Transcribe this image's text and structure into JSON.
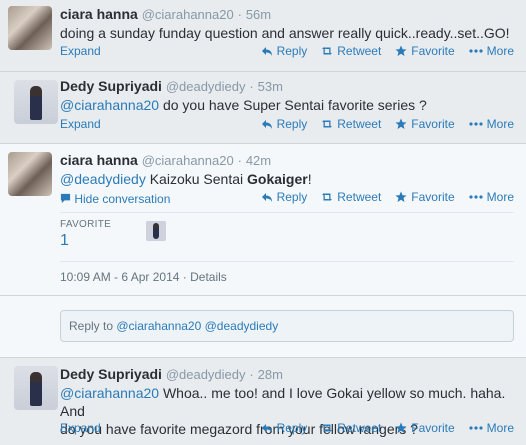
{
  "actions": {
    "reply": "Reply",
    "retweet": "Retweet",
    "favorite": "Favorite",
    "more": "More"
  },
  "tweets": [
    {
      "name": "ciara hanna",
      "handle": "@ciarahanna20",
      "sep": "·",
      "time": "56m",
      "text": "doing a sunday funday question and answer really quick..ready..set..GO!",
      "expand": "Expand"
    },
    {
      "name": "Dedy Supriyadi",
      "handle": "@deadydiedy",
      "sep": "·",
      "time": "53m",
      "mention": "@ciarahanna20",
      "text": " do you have Super Sentai favorite series ?",
      "expand": "Expand"
    },
    {
      "name": "ciara hanna",
      "handle": "@ciarahanna20",
      "sep": "·",
      "time": "42m",
      "mention": "@deadydiedy",
      "text_a": " Kaizoku Sentai ",
      "text_bold": "Gokaiger",
      "text_b": "!",
      "hide": "Hide conversation",
      "favorite_label": "FAVORITE",
      "favorite_count": "1",
      "timestamp": "10:09 AM - 6 Apr 2014",
      "details": "Details"
    },
    {
      "name": "Dedy Supriyadi",
      "handle": "@deadydiedy",
      "sep": "·",
      "time": "28m",
      "mention": "@ciarahanna20",
      "line1": " Whoa.. me too! and I love Gokai yellow so much. haha. And",
      "line2": "do you have favorite megazord from your fellow rangers ?",
      "expand": "Expand"
    }
  ],
  "reply_box": {
    "prefix": "Reply to ",
    "mention1": "@ciarahanna20",
    "mention2": "@deadydiedy"
  },
  "colors": {
    "link": "#2b7bb9",
    "meta": "#8899a6",
    "background": "#e8ecef"
  }
}
